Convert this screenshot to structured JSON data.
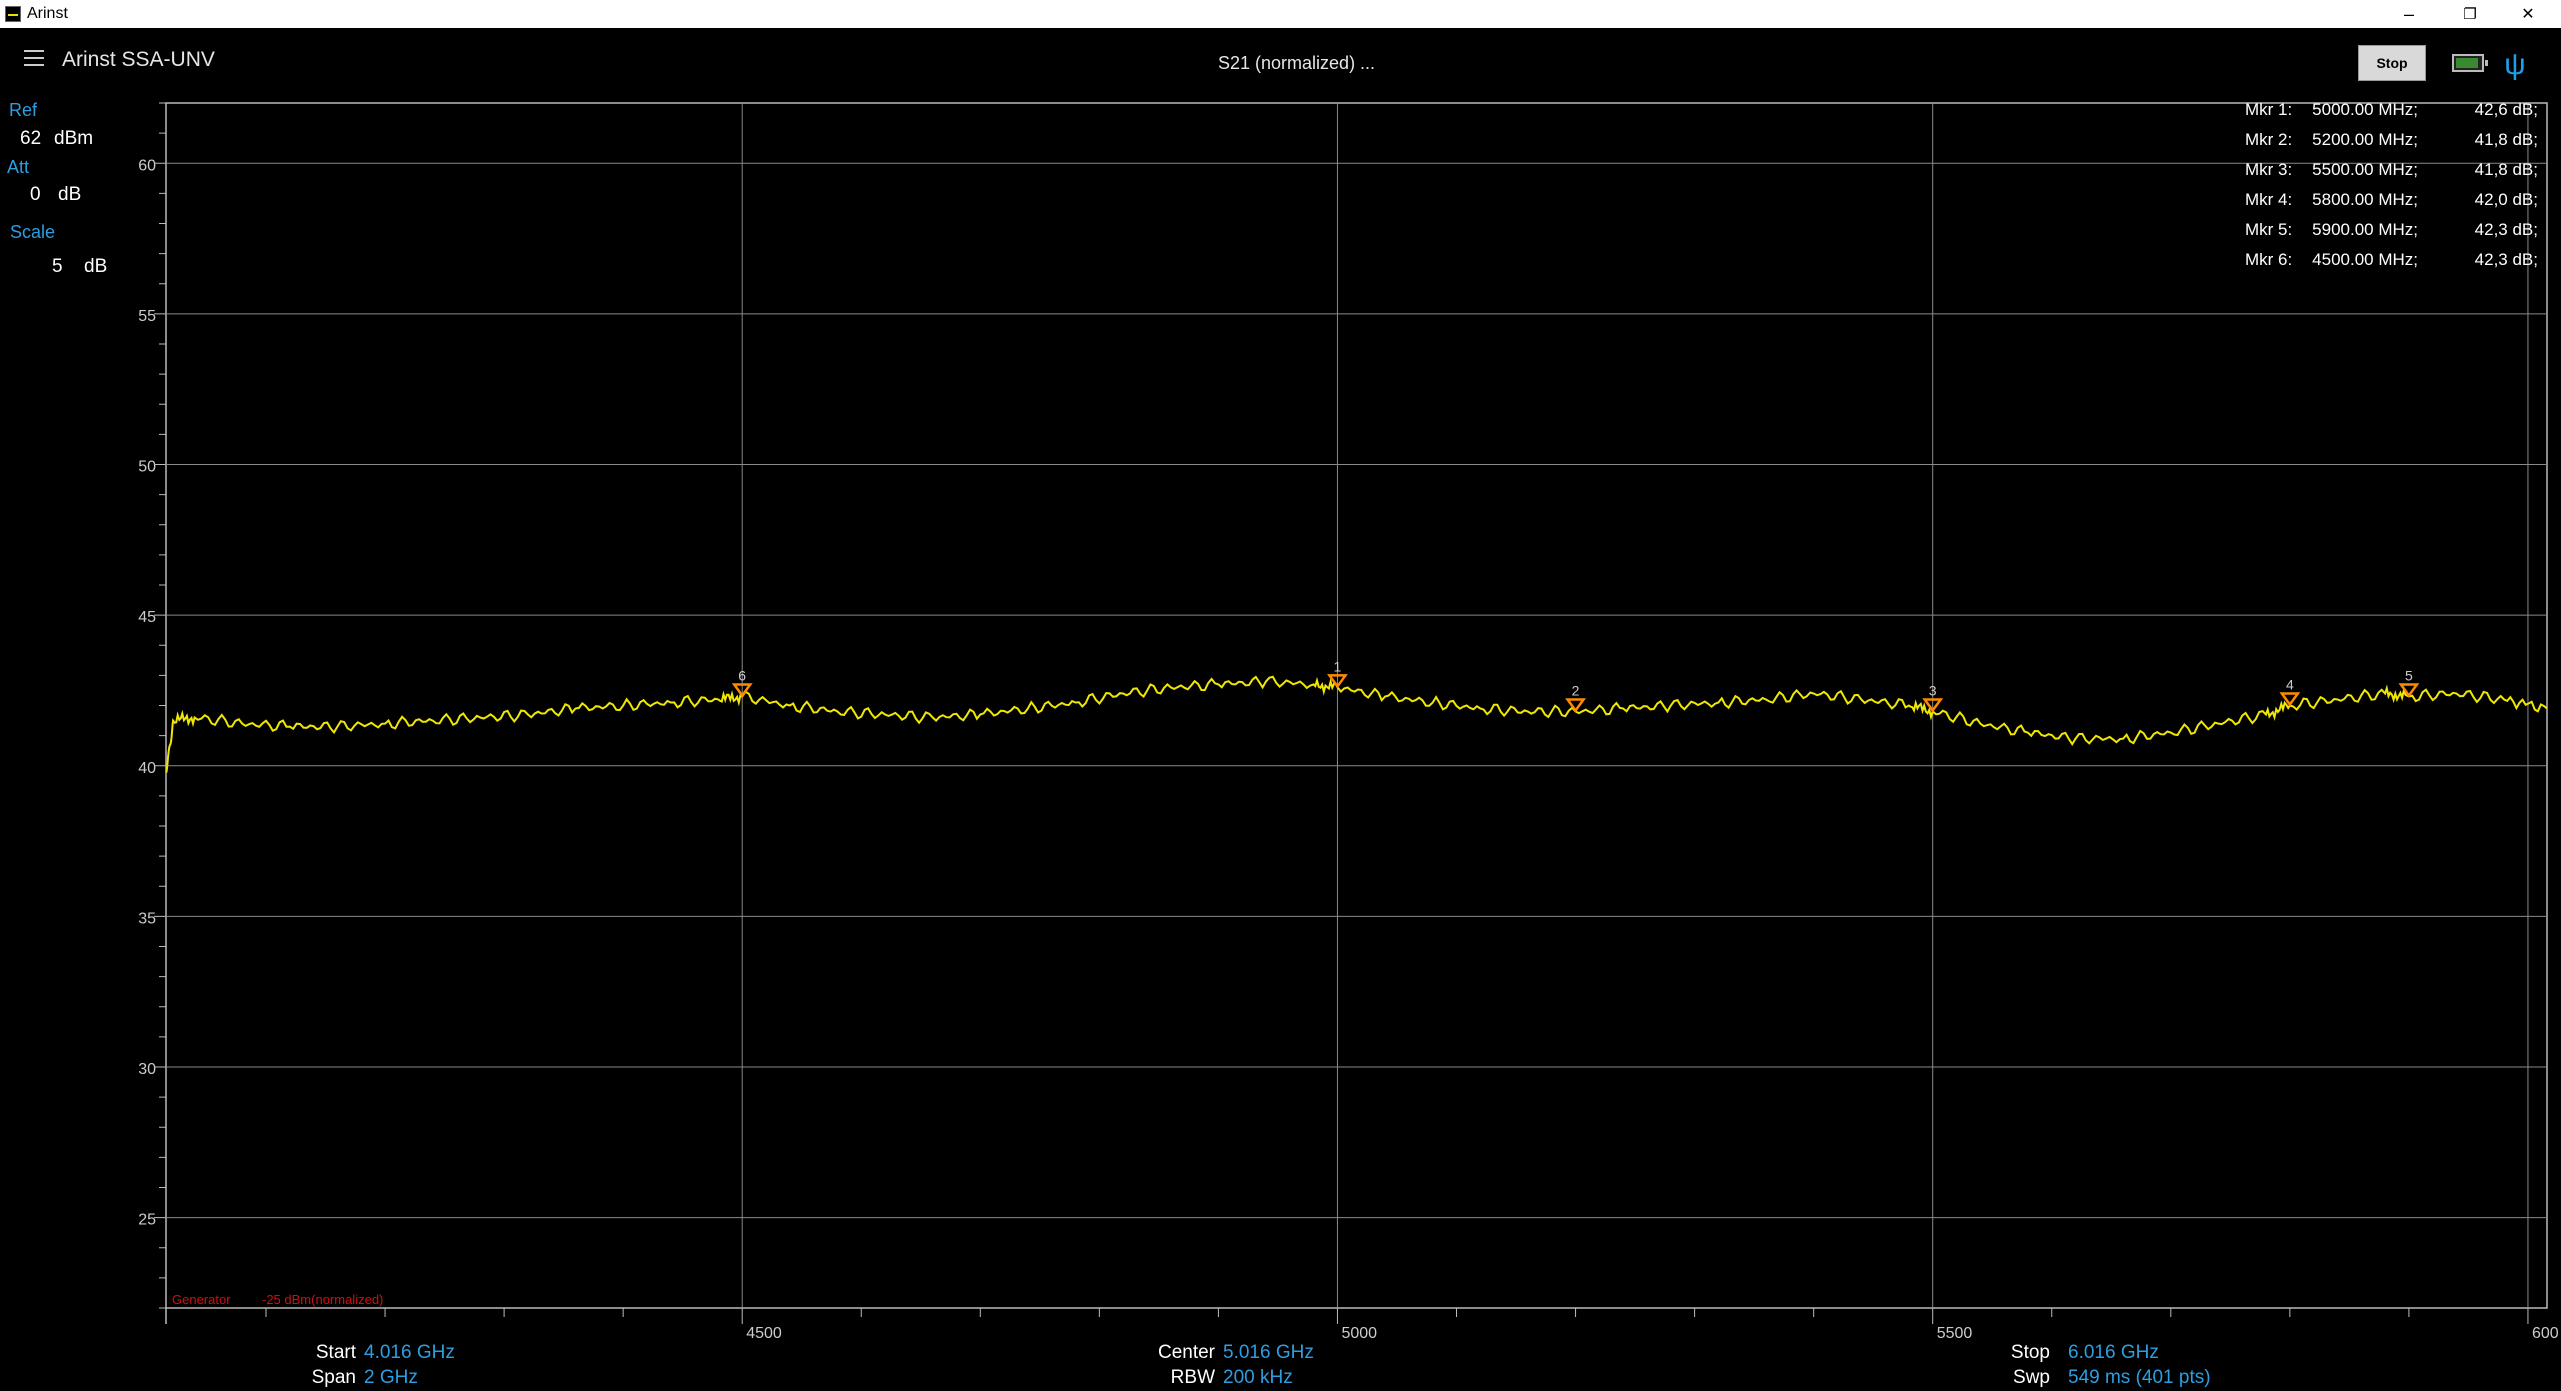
{
  "window": {
    "title": "Arinst",
    "minimize": "–",
    "restore": "❐",
    "close": "✕"
  },
  "header": {
    "app_name": "Arinst SSA-UNV",
    "mode": "S21 (normalized) ...",
    "stop_label": "Stop"
  },
  "settings": {
    "ref_label": "Ref",
    "ref_value": "62",
    "ref_unit": "dBm",
    "att_label": "Att",
    "att_value": "0",
    "att_unit": "dB",
    "scale_label": "Scale",
    "scale_value": "5",
    "scale_unit": "dB"
  },
  "markers": [
    {
      "name": "Mkr 1:",
      "freq": "5000.00 MHz;",
      "level": "42,6 dB;"
    },
    {
      "name": "Mkr 2:",
      "freq": "5200.00 MHz;",
      "level": "41,8 dB;"
    },
    {
      "name": "Mkr 3:",
      "freq": "5500.00 MHz;",
      "level": "41,8 dB;"
    },
    {
      "name": "Mkr 4:",
      "freq": "5800.00 MHz;",
      "level": "42,0 dB;"
    },
    {
      "name": "Mkr 5:",
      "freq": "5900.00 MHz;",
      "level": "42,3 dB;"
    },
    {
      "name": "Mkr 6:",
      "freq": "4500.00 MHz;",
      "level": "42,3 dB;"
    }
  ],
  "footer": {
    "start_label": "Start",
    "start_value": "4.016 GHz",
    "span_label": "Span",
    "span_value": "2 GHz",
    "center_label": "Center",
    "center_value": "5.016 GHz",
    "rbw_label": "RBW",
    "rbw_value": "200 kHz",
    "stop_label": "Stop",
    "stop_value": "6.016 GHz",
    "swp_label": "Swp",
    "swp_value": "549  ms (401 pts)",
    "generator_label": "Generator",
    "generator_value": "-25 dBm(normalized)"
  },
  "colors": {
    "trace": "#f0e800",
    "marker": "#ff8a00",
    "grid": "#8a8a8a",
    "accent": "#2d9ee0",
    "generator": "#d01010"
  },
  "chart_data": {
    "type": "line",
    "x_unit": "MHz",
    "xlim": [
      4016,
      6016
    ],
    "ylim": [
      22,
      62
    ],
    "y_ticks": [
      25,
      30,
      35,
      40,
      45,
      50,
      55,
      60
    ],
    "x_ticks": [
      4500,
      5000,
      5500,
      6000
    ],
    "y_tick_labels": [
      "25",
      "30",
      "35",
      "40",
      "45",
      "50",
      "55",
      "60"
    ],
    "x_tick_labels": [
      "4500",
      "5000",
      "5500",
      "600"
    ],
    "grid": true,
    "series": [
      {
        "x": [
          4016,
          4022,
          4040,
          4080,
          4120,
          4160,
          4200,
          4240,
          4280,
          4320,
          4360,
          4400,
          4440,
          4480,
          4500,
          4540,
          4580,
          4620,
          4660,
          4700,
          4740,
          4780,
          4820,
          4860,
          4900,
          4940,
          4980,
          5000,
          5040,
          5080,
          5120,
          5160,
          5200,
          5240,
          5280,
          5320,
          5360,
          5400,
          5440,
          5480,
          5500,
          5540,
          5580,
          5620,
          5660,
          5700,
          5740,
          5780,
          5800,
          5840,
          5880,
          5900,
          5940,
          5980,
          6016
        ],
        "y": [
          39.8,
          41.5,
          41.6,
          41.4,
          41.3,
          41.3,
          41.4,
          41.5,
          41.6,
          41.7,
          41.9,
          42.0,
          42.1,
          42.2,
          42.3,
          42.0,
          41.8,
          41.7,
          41.6,
          41.7,
          41.9,
          42.1,
          42.4,
          42.6,
          42.7,
          42.8,
          42.7,
          42.6,
          42.3,
          42.1,
          41.9,
          41.8,
          41.8,
          41.9,
          42.0,
          42.1,
          42.2,
          42.4,
          42.2,
          42.0,
          41.8,
          41.4,
          41.1,
          40.9,
          40.9,
          41.1,
          41.4,
          41.7,
          42.0,
          42.2,
          42.4,
          42.3,
          42.4,
          42.2,
          41.9
        ]
      }
    ],
    "markers": [
      {
        "label": "1",
        "x": 5000,
        "y": 42.6
      },
      {
        "label": "2",
        "x": 5200,
        "y": 41.8
      },
      {
        "label": "3",
        "x": 5500,
        "y": 41.8
      },
      {
        "label": "4",
        "x": 5800,
        "y": 42.0
      },
      {
        "label": "5",
        "x": 5900,
        "y": 42.3
      },
      {
        "label": "6",
        "x": 4500,
        "y": 42.3
      }
    ]
  }
}
